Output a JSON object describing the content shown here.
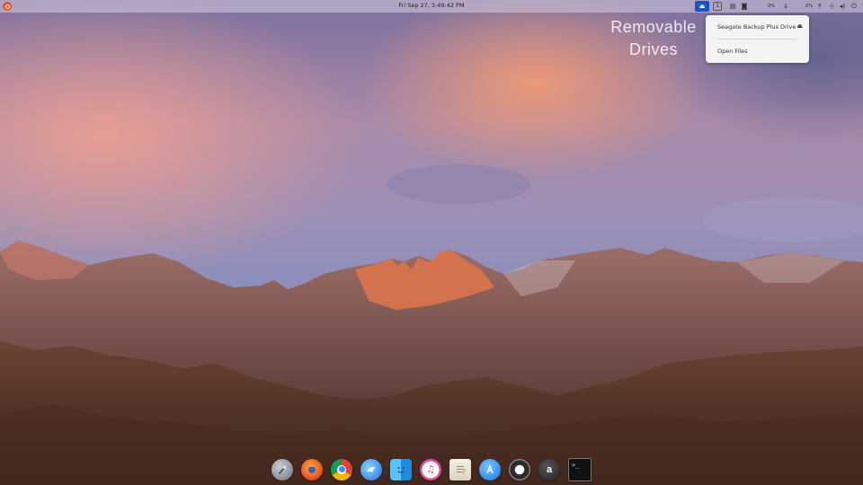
{
  "topbar": {
    "clock": "Fri Sep 27,   3:49:42 PM",
    "workspace_number": "1",
    "cpu_label_1": "0%",
    "cpu_label_2": "0%"
  },
  "overlay": {
    "line1": "Removable",
    "line2": "Drives"
  },
  "removable_drives_menu": {
    "items": [
      {
        "label": "Seagate Backup Plus Drive",
        "icon": "eject-icon"
      },
      {
        "label": "Open Files"
      }
    ]
  },
  "dock": {
    "items": [
      {
        "name": "launchpad",
        "icon": "rocket-icon"
      },
      {
        "name": "firefox",
        "icon": "firefox-icon"
      },
      {
        "name": "chrome",
        "icon": "chrome-icon"
      },
      {
        "name": "thunderbird",
        "icon": "bird-icon"
      },
      {
        "name": "finder",
        "icon": "finder-icon"
      },
      {
        "name": "itunes",
        "icon": "music-icon"
      },
      {
        "name": "text-editor",
        "icon": "document-icon"
      },
      {
        "name": "app-store",
        "icon": "app-store-icon"
      },
      {
        "name": "settings",
        "icon": "gear-icon"
      },
      {
        "name": "amazon",
        "icon": "amazon-icon"
      },
      {
        "name": "terminal",
        "icon": "terminal-icon"
      }
    ]
  },
  "colors": {
    "accent_blue": "#1553c7",
    "ubuntu_orange": "#e95420"
  }
}
